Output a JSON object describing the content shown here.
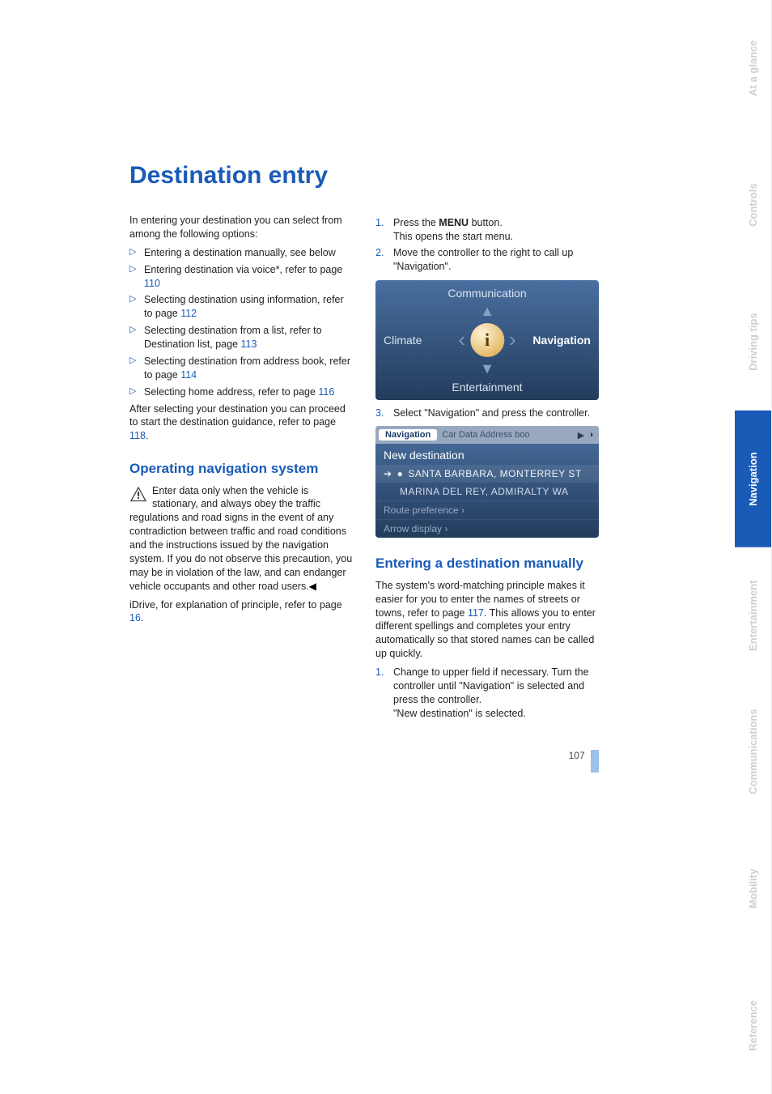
{
  "title": "Destination entry",
  "intro": "In entering your destination you can select from among the following options:",
  "options": [
    {
      "text": "Entering a destination manually, see below"
    },
    {
      "text": "Entering destination via voice*, refer to page ",
      "page": "110"
    },
    {
      "text": "Selecting destination using information, refer to page ",
      "page": "112"
    },
    {
      "text": "Selecting destination from a list, refer to Destination list, page ",
      "page": "113"
    },
    {
      "text": "Selecting destination from address book, refer to page ",
      "page": "114"
    },
    {
      "text": "Selecting home address, refer to page ",
      "page": "116"
    }
  ],
  "after_select": {
    "pre": "After selecting your destination you can proceed to start the destination guidance, refer to page ",
    "page": "118",
    "post": "."
  },
  "section_operating": "Operating navigation system",
  "caution": "Enter data only when the vehicle is stationary, and always obey the traffic regulations and road signs in the event of any contradiction between traffic and road conditions and the instructions issued by the navigation system. If you do not observe this precaution, you may be in violation of the law, and can endanger vehicle occupants and other road users.",
  "idrive": {
    "pre": "iDrive, for explanation of principle, refer to page ",
    "page": "16",
    "post": "."
  },
  "right": {
    "step1a": "Press the ",
    "step1b": "MENU",
    "step1c": " button.",
    "step1d": "This opens the start menu.",
    "step2": "Move the controller to the right to call up \"Navigation\".",
    "step3": "Select \"Navigation\" and press the controller."
  },
  "ss1": {
    "top": "Communication",
    "left": "Climate",
    "right": "Navigation",
    "bottom": "Entertainment",
    "center": "i"
  },
  "ss2": {
    "tab_active": "Navigation",
    "tab_rest": "Car Data  Address boo",
    "row_dest": "New destination",
    "row_sel": "SANTA BARBARA, MONTERREY ST",
    "row_sub": "MARINA DEL REY, ADMIRALTY WA",
    "row_pref": "Route preference  ›",
    "row_arrow": "Arrow display  ›"
  },
  "section_manual": "Entering a destination manually",
  "manual_para": {
    "pre": "The system's word-matching principle makes it easier for you to enter the names of streets or towns, refer to page ",
    "page": "117",
    "post": ". This allows you to enter different spellings and completes your entry automatically so that stored names can be called up quickly."
  },
  "manual_step1": "Change to upper field if necessary. Turn the controller until \"Navigation\" is selected and press the controller.",
  "manual_step1b": "\"New destination\" is selected.",
  "sidetabs": [
    "Reference",
    "Mobility",
    "Communications",
    "Entertainment",
    "Navigation",
    "Driving tips",
    "Controls",
    "At a glance"
  ],
  "active_tab_index": 4,
  "page_number": "107"
}
